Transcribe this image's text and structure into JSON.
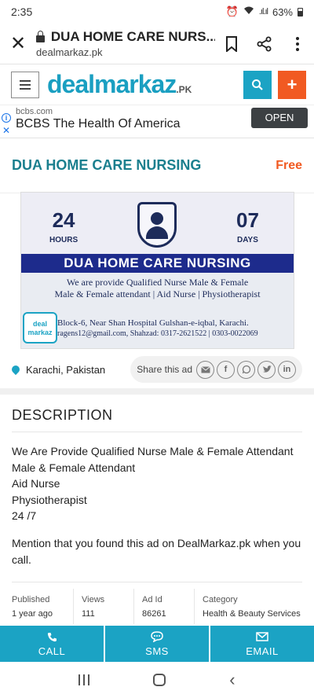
{
  "status_bar": {
    "time": "2:35",
    "battery": "63%"
  },
  "browser": {
    "page_title": "DUA HOME CARE NURS...",
    "domain": "dealmarkaz.pk"
  },
  "site": {
    "logo_main": "dealmarkaz",
    "logo_suffix": ".PK",
    "plus_label": "+"
  },
  "ad_banner": {
    "domain": "bcbs.com",
    "headline": "BCBS The Health Of America",
    "open_label": "OPEN"
  },
  "listing": {
    "title": "DUA HOME CARE NURSING",
    "price": "Free",
    "location": "Karachi, Pakistan",
    "share_label": "Share this ad"
  },
  "image_text": {
    "hours_num": "24",
    "hours_label": "HOURS",
    "days_num": "07",
    "days_label": "DAYS",
    "band": "DUA HOME CARE NURSING",
    "line1": "We are provide Qualified Nurse Male & Female",
    "line2": "Male & Female attendant | Aid Nurse | Physiotherapist",
    "line3": "Block-6, Near Shan Hospital Gulshan-e-iqbal, Karachi.",
    "line4": "ragens12@gmail.com, Shahzad: 0317-2621522 | 0303-0022069",
    "watermark": "deal markaz"
  },
  "description": {
    "heading": "DESCRIPTION",
    "lines": [
      "We Are Provide Qualified Nurse Male & Female Attendant",
      "Male & Female Attendant",
      "Aid Nurse",
      "Physiotherapist",
      "24 /7"
    ],
    "mention": "Mention that you found this ad on DealMarkaz.pk when you call."
  },
  "meta": {
    "published_label": "Published",
    "published_value": "1 year ago",
    "views_label": "Views",
    "views_value": "111",
    "adid_label": "Ad Id",
    "adid_value": "86261",
    "category_label": "Category",
    "category_value": "Health & Beauty Services"
  },
  "actions": {
    "call": "CALL",
    "sms": "SMS",
    "email": "EMAIL"
  },
  "colors": {
    "brand": "#1ba3c4",
    "accent": "#f15a22",
    "title": "#1a7f8e"
  }
}
